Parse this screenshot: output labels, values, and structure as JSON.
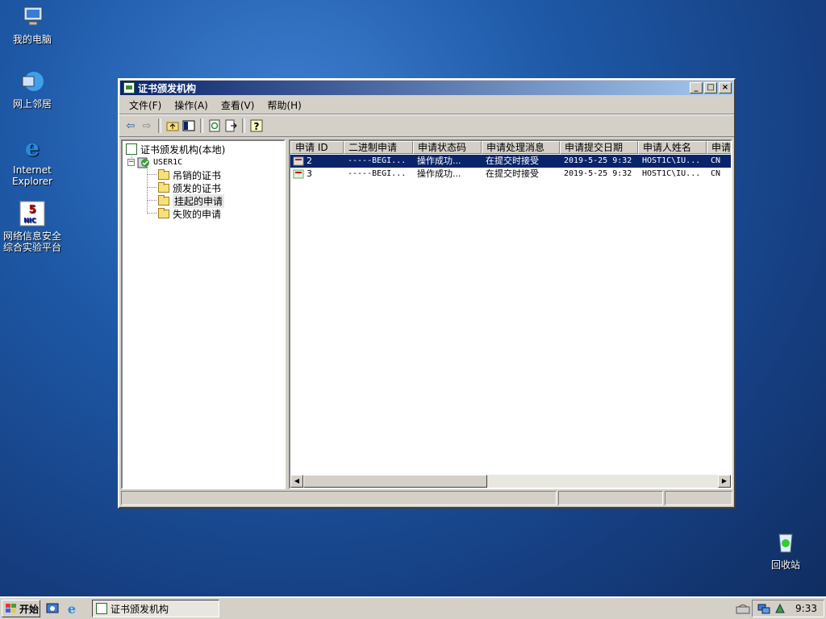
{
  "desktop": {
    "icons": [
      {
        "label": "我的电脑",
        "icon": "computer-icon"
      },
      {
        "label": "网上邻居",
        "icon": "network-icon"
      },
      {
        "label_line1": "Internet",
        "label_line2": "Explorer",
        "icon": "ie-icon"
      },
      {
        "label_line1": "网络信息安全",
        "label_line2": "综合实验平台",
        "icon": "nic-icon",
        "badge": "5",
        "badge_sub": "NIC"
      },
      {
        "label": "回收站",
        "icon": "recycle-bin-icon"
      }
    ]
  },
  "window": {
    "title": "证书颁发机构",
    "menu": [
      "文件(F)",
      "操作(A)",
      "查看(V)",
      "帮助(H)"
    ],
    "tree": {
      "root": "证书颁发机构(本地)",
      "ca": "USER1C",
      "folders": [
        "吊销的证书",
        "颁发的证书",
        "挂起的申请",
        "失败的申请"
      ],
      "selected_index": 2
    },
    "columns": [
      "申请 ID",
      "二进制申请",
      "申请状态码",
      "申请处理消息",
      "申请提交日期",
      "申请人姓名",
      "申请"
    ],
    "rows": [
      {
        "id": "2",
        "binary": "-----BEGI...",
        "status": "操作成功...",
        "message": "在提交时接受",
        "date": "2019-5-25 9:32",
        "requester": "HOST1C\\IU...",
        "extra": "CN"
      },
      {
        "id": "3",
        "binary": "-----BEGI...",
        "status": "操作成功...",
        "message": "在提交时接受",
        "date": "2019-5-25 9:32",
        "requester": "HOST1C\\IU...",
        "extra": "CN"
      }
    ]
  },
  "taskbar": {
    "start_label": "开始",
    "task_label": "证书颁发机构",
    "clock": "9:33"
  }
}
